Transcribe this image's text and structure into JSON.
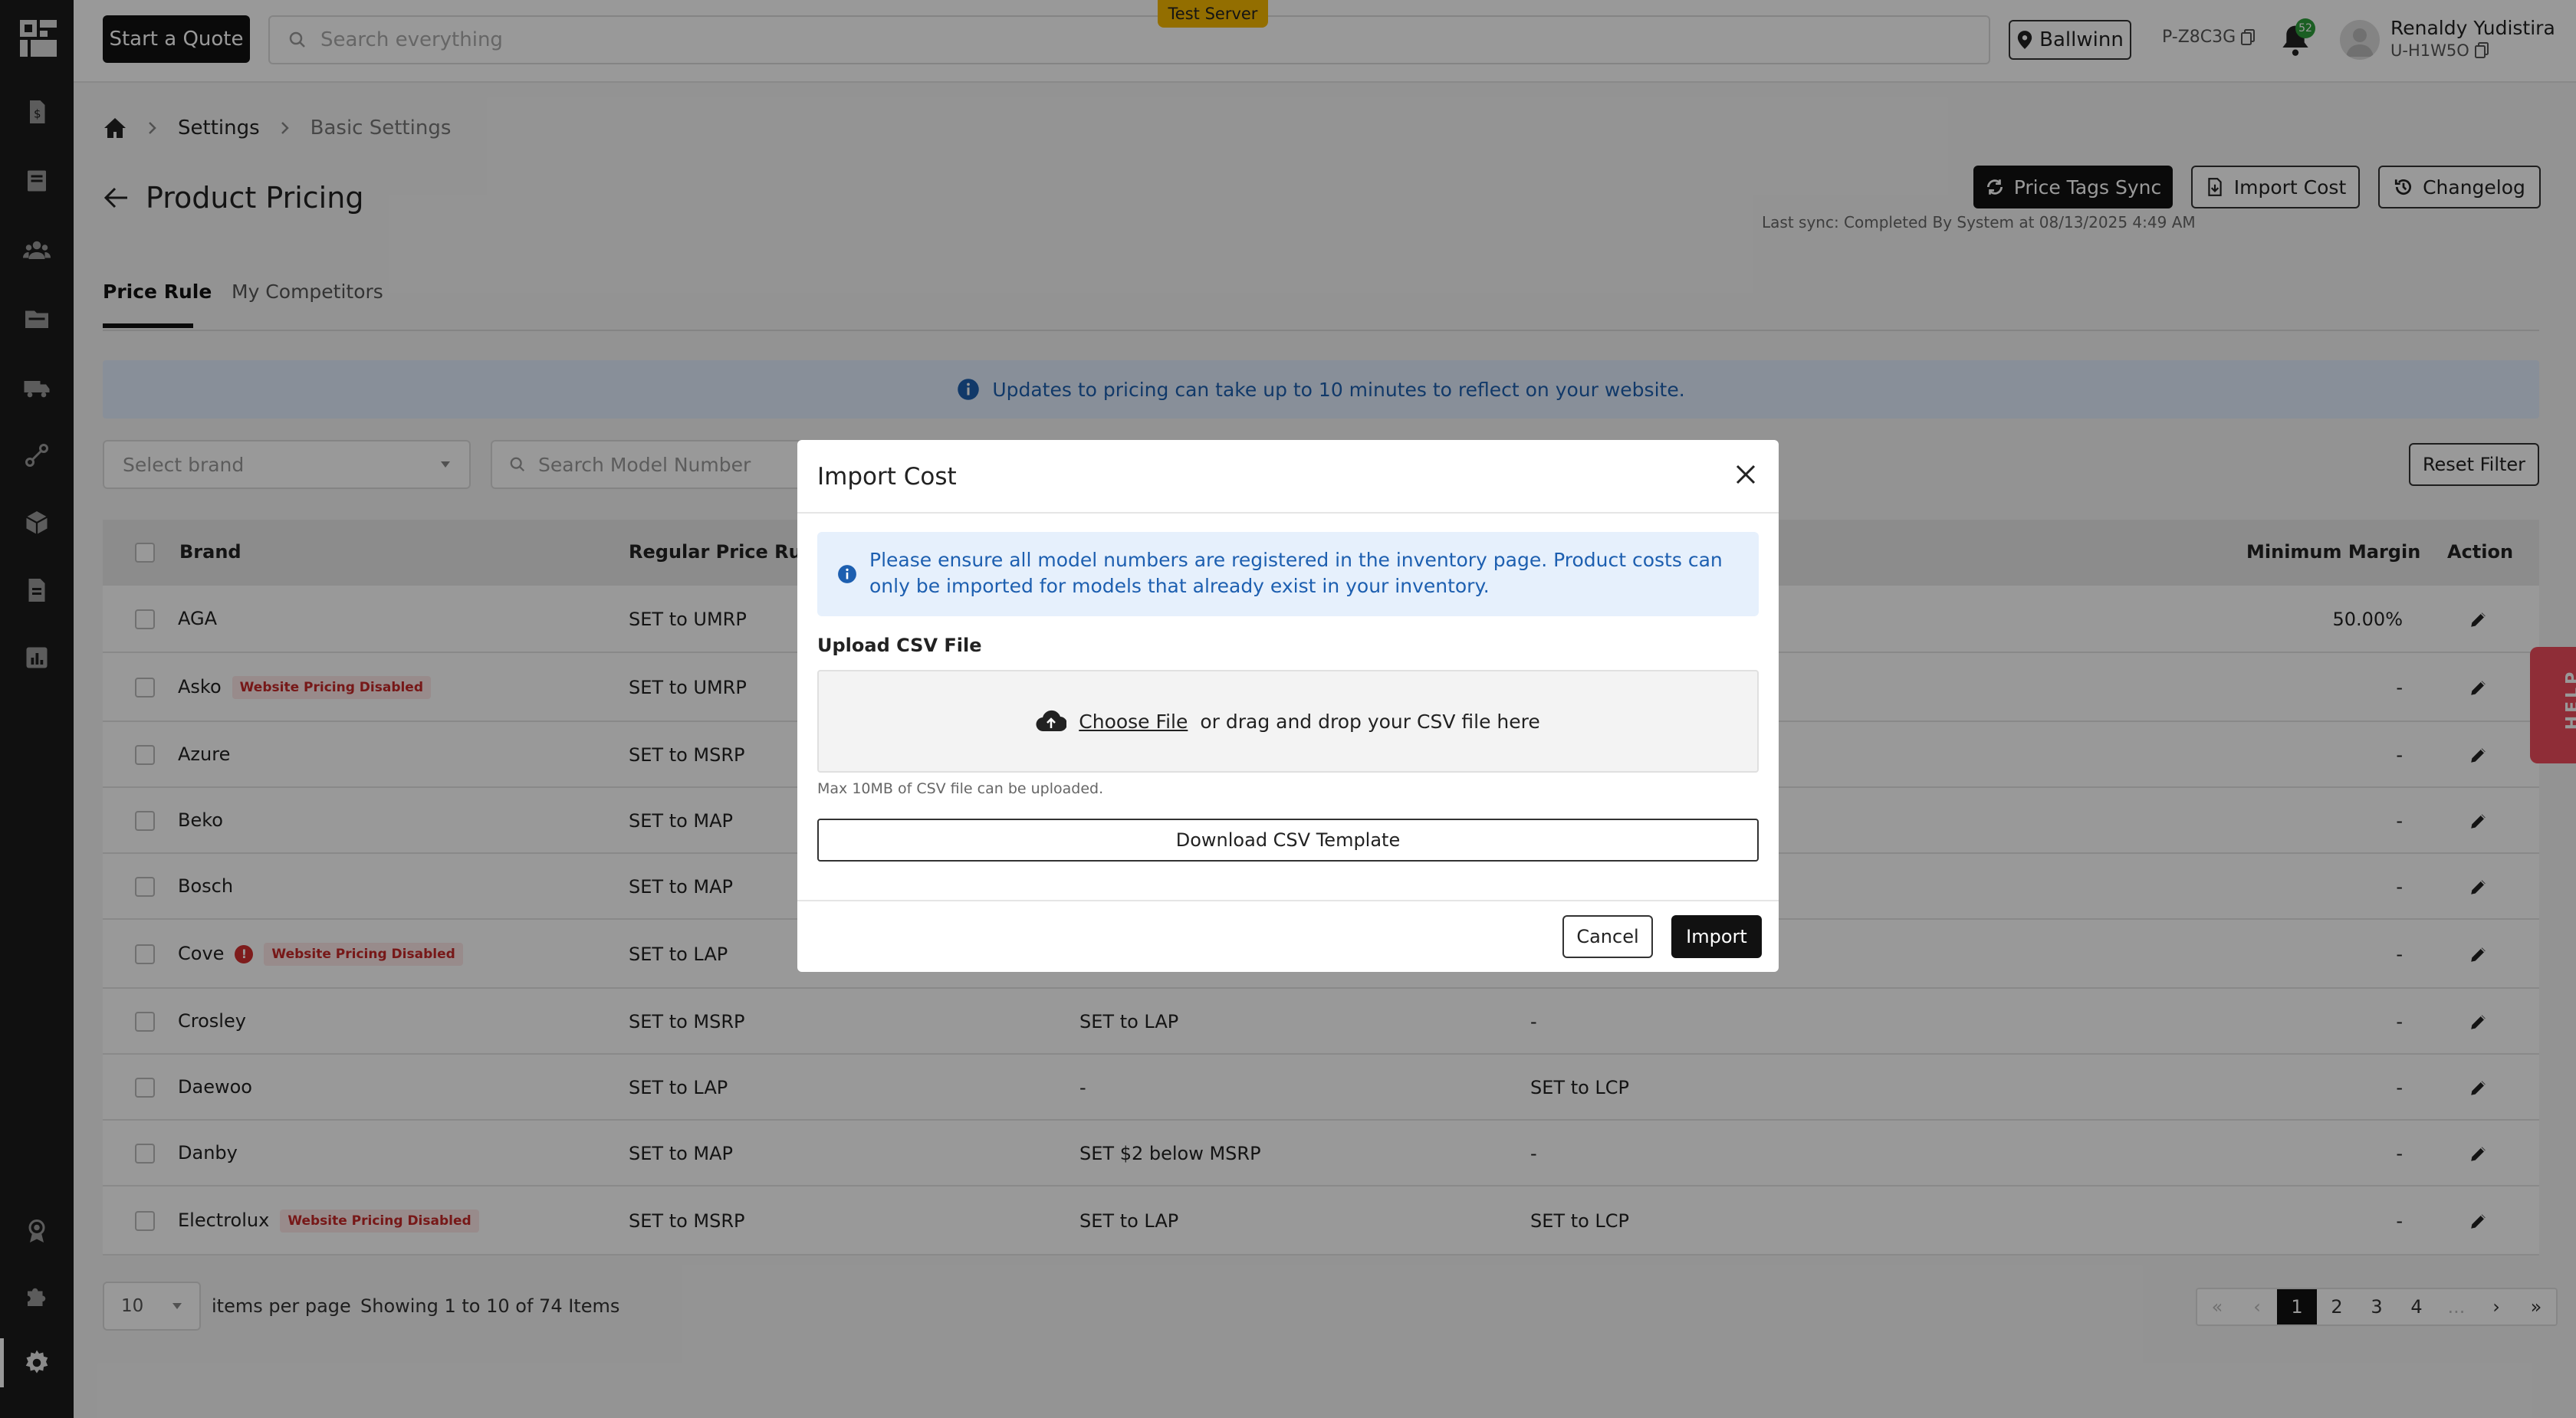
{
  "topbar": {
    "quote_button": "Start a Quote",
    "search_placeholder": "Search everything",
    "server_badge": "Test Server",
    "location": "Ballwinn",
    "store_code": "P-Z8C3G",
    "notification_count": "52",
    "user_name": "Renaldy Yudistira",
    "user_id": "U-H1W5O"
  },
  "breadcrumb": {
    "settings": "Settings",
    "current": "Basic Settings"
  },
  "page": {
    "title": "Product Pricing",
    "sync_button": "Price Tags Sync",
    "import_button": "Import Cost",
    "changelog_button": "Changelog",
    "last_sync": "Last sync: Completed By System at 08/13/2025 4:49 AM"
  },
  "tabs": [
    "Price Rule",
    "My Competitors"
  ],
  "banner": "Updates to pricing can take up to 10 minutes to reflect on your website.",
  "filters": {
    "brand_placeholder": "Select brand",
    "model_placeholder": "Search Model Number",
    "reset": "Reset Filter"
  },
  "table": {
    "headers": {
      "brand": "Brand",
      "regular": "Regular Price Rule",
      "min_margin": "Minimum Margin",
      "action": "Action"
    },
    "rows": [
      {
        "brand": "AGA",
        "badge": "",
        "warn": "",
        "regular": "SET to UMRP",
        "col3": "",
        "col4": "",
        "margin": "50.00%"
      },
      {
        "brand": "Asko",
        "badge": "Website Pricing Disabled",
        "warn": "",
        "regular": "SET to UMRP",
        "col3": "",
        "col4": "",
        "margin": "-"
      },
      {
        "brand": "Azure",
        "badge": "",
        "warn": "",
        "regular": "SET to MSRP",
        "col3": "",
        "col4": "",
        "margin": "-"
      },
      {
        "brand": "Beko",
        "badge": "",
        "warn": "",
        "regular": "SET to MAP",
        "col3": "",
        "col4": "",
        "margin": "-"
      },
      {
        "brand": "Bosch",
        "badge": "",
        "warn": "",
        "regular": "SET to MAP",
        "col3": "",
        "col4": "",
        "margin": "-"
      },
      {
        "brand": "Cove",
        "badge": "Website Pricing Disabled",
        "warn": "!",
        "regular": "SET to LAP",
        "col3": "",
        "col4": "",
        "margin": "-"
      },
      {
        "brand": "Crosley",
        "badge": "",
        "warn": "",
        "regular": "SET to MSRP",
        "col3": "SET to LAP",
        "col4": "-",
        "margin": "-"
      },
      {
        "brand": "Daewoo",
        "badge": "",
        "warn": "",
        "regular": "SET to LAP",
        "col3": "-",
        "col4": "SET to LCP",
        "margin": "-"
      },
      {
        "brand": "Danby",
        "badge": "",
        "warn": "",
        "regular": "SET to MAP",
        "col3": "SET $2 below MSRP",
        "col4": "-",
        "margin": "-"
      },
      {
        "brand": "Electrolux",
        "badge": "Website Pricing Disabled",
        "warn": "",
        "regular": "SET to MSRP",
        "col3": "SET to LAP",
        "col4": "SET to LCP",
        "margin": "-"
      }
    ]
  },
  "pagination": {
    "per_page": "10",
    "per_page_label": "items per page",
    "showing": "Showing 1 to 10 of 74 Items",
    "pages": [
      "«",
      "‹",
      "1",
      "2",
      "3",
      "4",
      "...",
      "›",
      "»"
    ]
  },
  "help": "HELP",
  "modal": {
    "title": "Import Cost",
    "info": "Please ensure all model numbers are registered in the inventory page. Product costs can only be imported for models that already exist in your inventory.",
    "upload_label": "Upload CSV File",
    "choose_file": "Choose File",
    "drop_text": "or drag and drop your CSV file here",
    "max_note": "Max 10MB of CSV file can be uploaded.",
    "download_button": "Download CSV Template",
    "cancel": "Cancel",
    "import": "Import"
  }
}
